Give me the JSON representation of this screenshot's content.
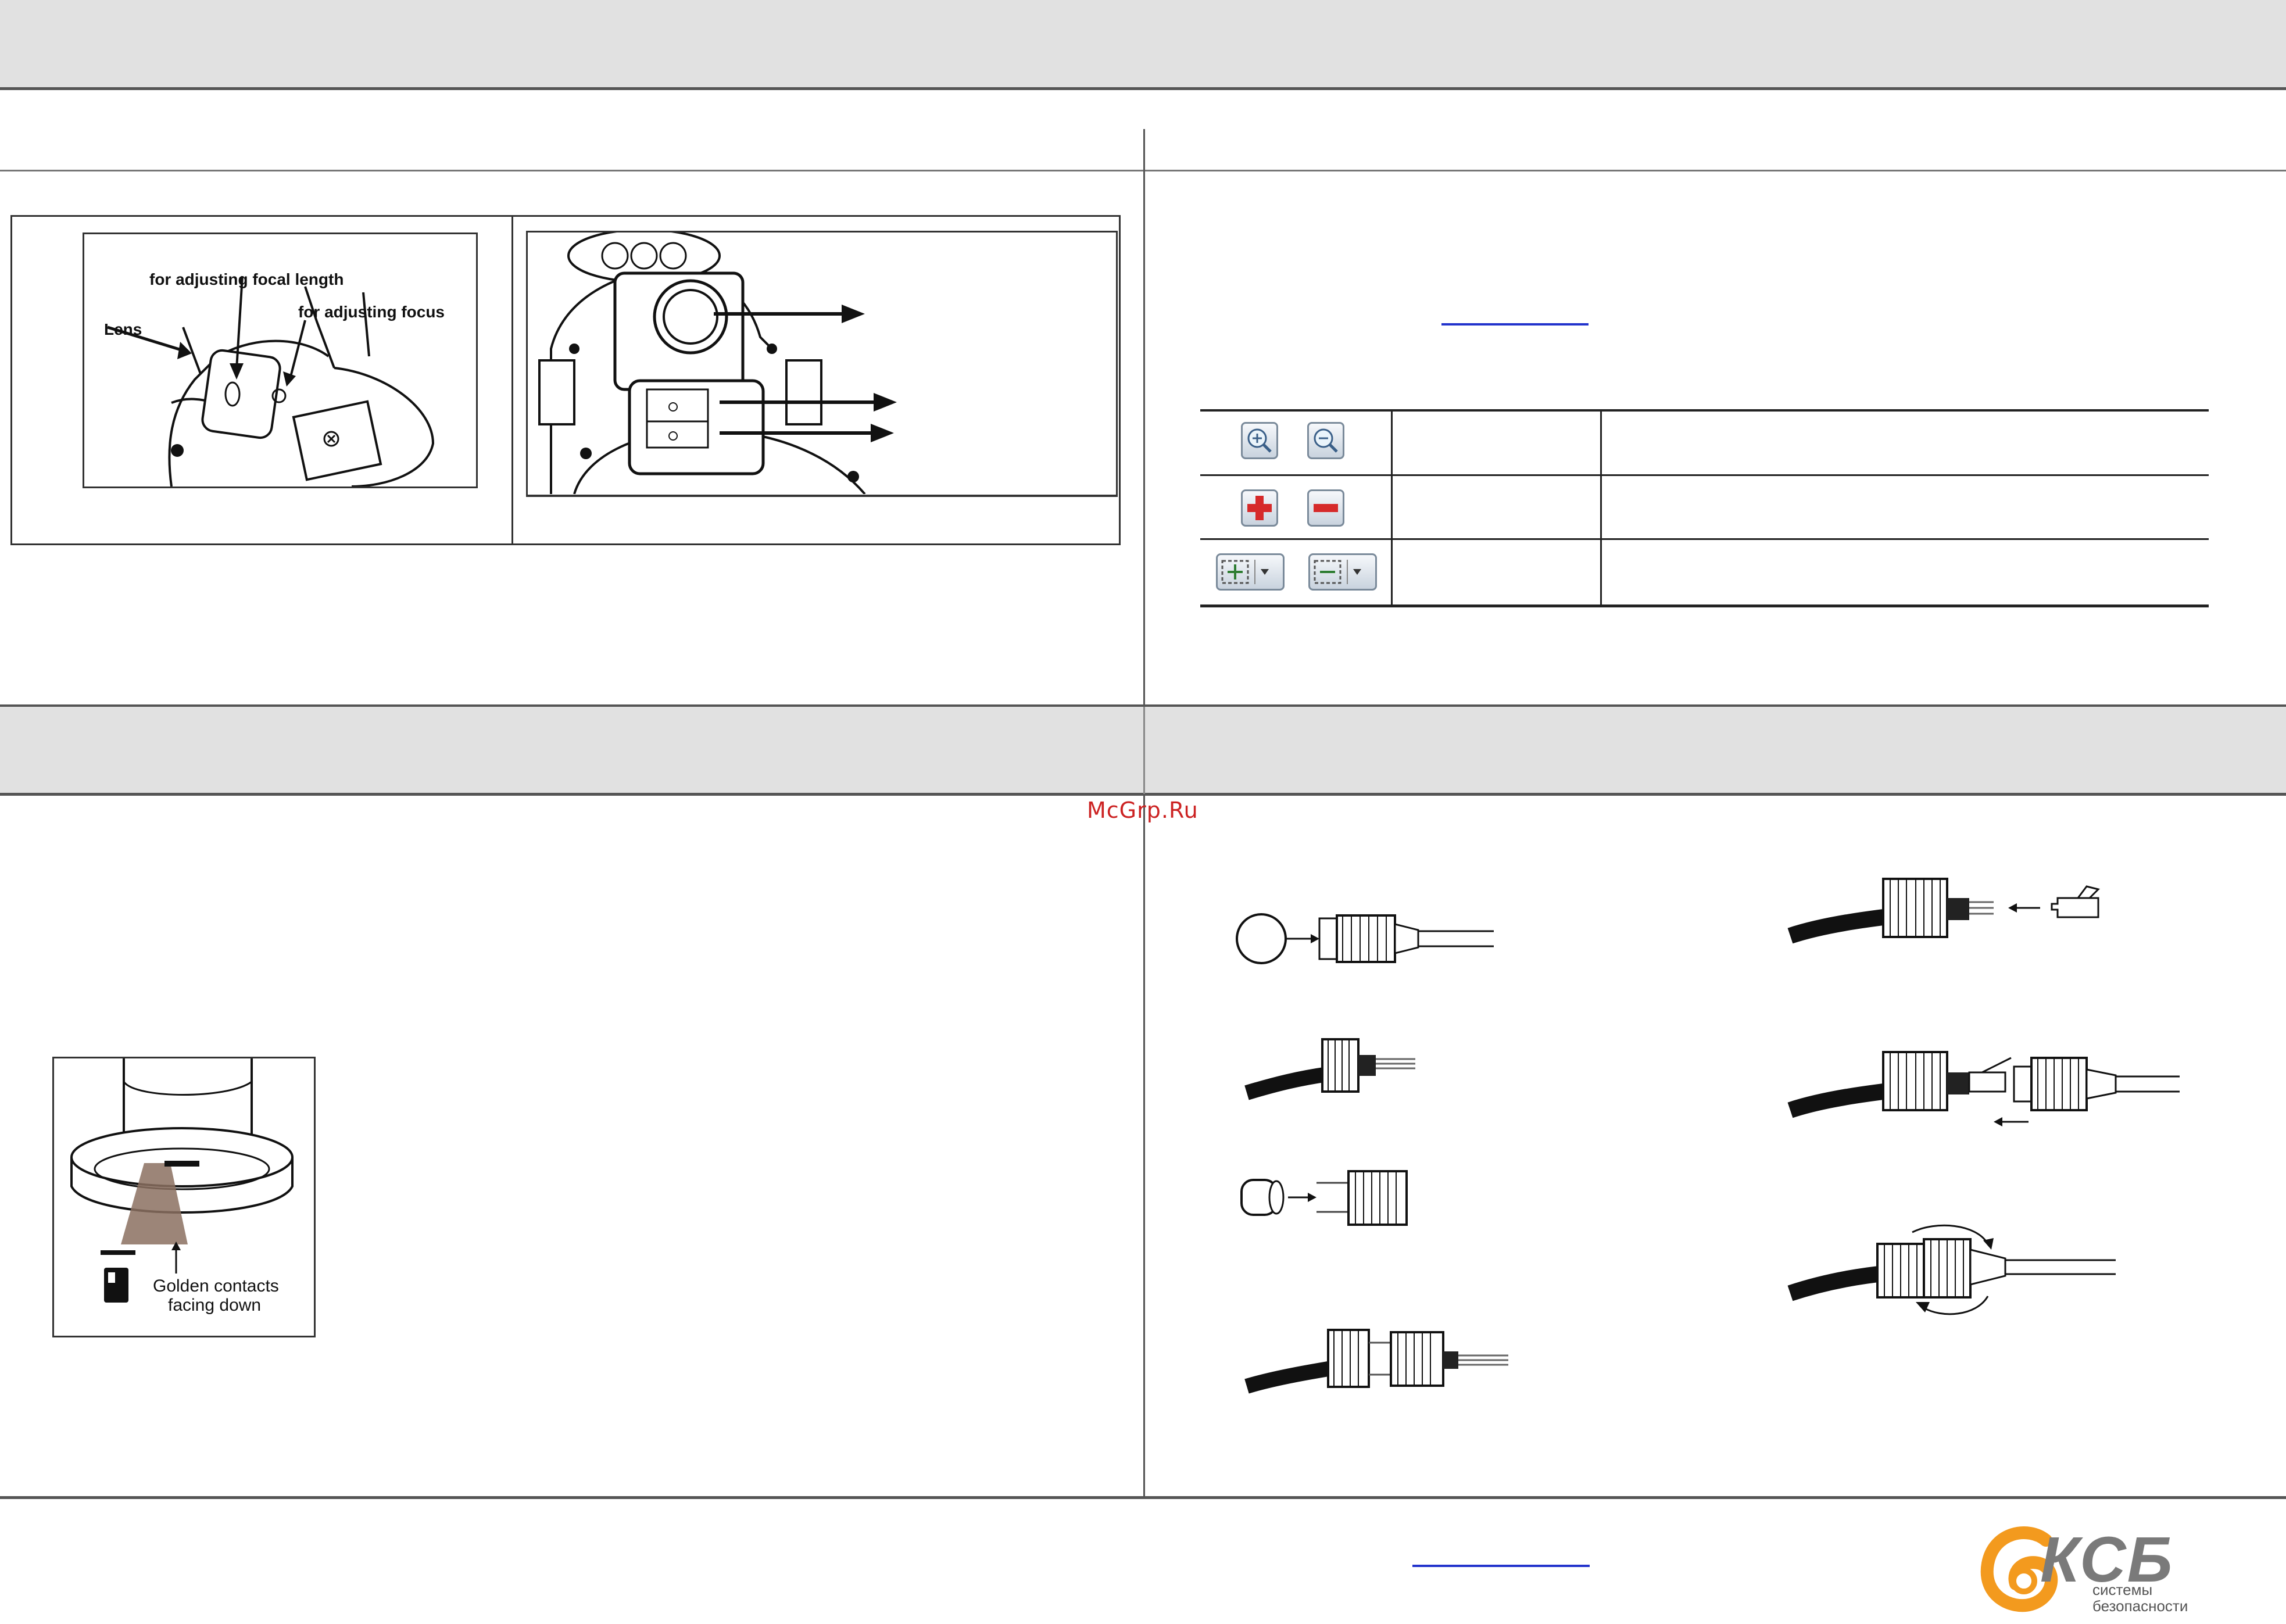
{
  "watermark": "McGrp.Ru",
  "focus_figure": {
    "label_focal_length": "for adjusting focal length",
    "label_focus": "for adjusting focus",
    "label_lens": "Lens"
  },
  "sd_figure": {
    "caption_line1": "Golden contacts",
    "caption_line2": "facing down"
  },
  "zoom_controls": {
    "rows": [
      {
        "icons": [
          "zoom-in-icon",
          "zoom-out-icon"
        ]
      },
      {
        "icons": [
          "plus-icon",
          "minus-icon"
        ]
      },
      {
        "icons": [
          "zoom-area-plus-icon",
          "zoom-area-minus-icon"
        ]
      }
    ]
  },
  "logo": {
    "brand": "КСБ",
    "line1": "системы",
    "line2": "безопасности",
    "colors": {
      "orange": "#f39a1e",
      "gray": "#7a7a7a"
    }
  },
  "colors": {
    "band": "#e1e1e1",
    "rule": "#555555",
    "link": "#2233cc",
    "watermark": "#cc2222"
  }
}
